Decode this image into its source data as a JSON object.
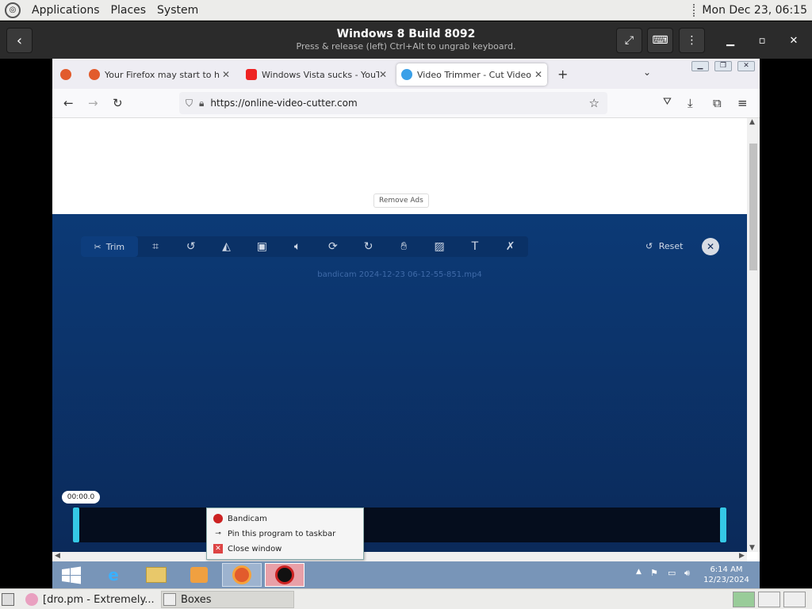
{
  "gnome_panel": {
    "menus": [
      "Applications",
      "Places",
      "System"
    ],
    "clock": "Mon Dec 23, 06:15"
  },
  "boxes": {
    "title": "Windows 8 Build 8092",
    "subtitle": "Press & release (left) Ctrl+Alt to ungrab keyboard."
  },
  "firefox": {
    "tabs": [
      {
        "label": "Your Firefox may start to have p"
      },
      {
        "label": "Windows Vista sucks - YouTube"
      },
      {
        "label": "Video Trimmer - Cut Video Onl"
      }
    ],
    "url": "https://online-video-cutter.com"
  },
  "page": {
    "remove_ads": "Remove Ads",
    "trim_label": "Trim",
    "reset_label": "Reset",
    "filename": "bandicam 2024-12-23 06-12-55-851.mp4",
    "timecode": "00:00.0"
  },
  "jumplist": {
    "items": [
      "Bandicam",
      "Pin this program to taskbar",
      "Close window"
    ]
  },
  "vm_clock": {
    "time": "6:14 AM",
    "date": "12/23/2024"
  },
  "gnome_bottom": {
    "items": [
      "[dro.pm - Extremely...",
      "Boxes"
    ]
  },
  "colors": {
    "editor_bg": "#0b2a5a",
    "accent_handle": "#35c8e6",
    "taskbar": "#7895b8"
  }
}
